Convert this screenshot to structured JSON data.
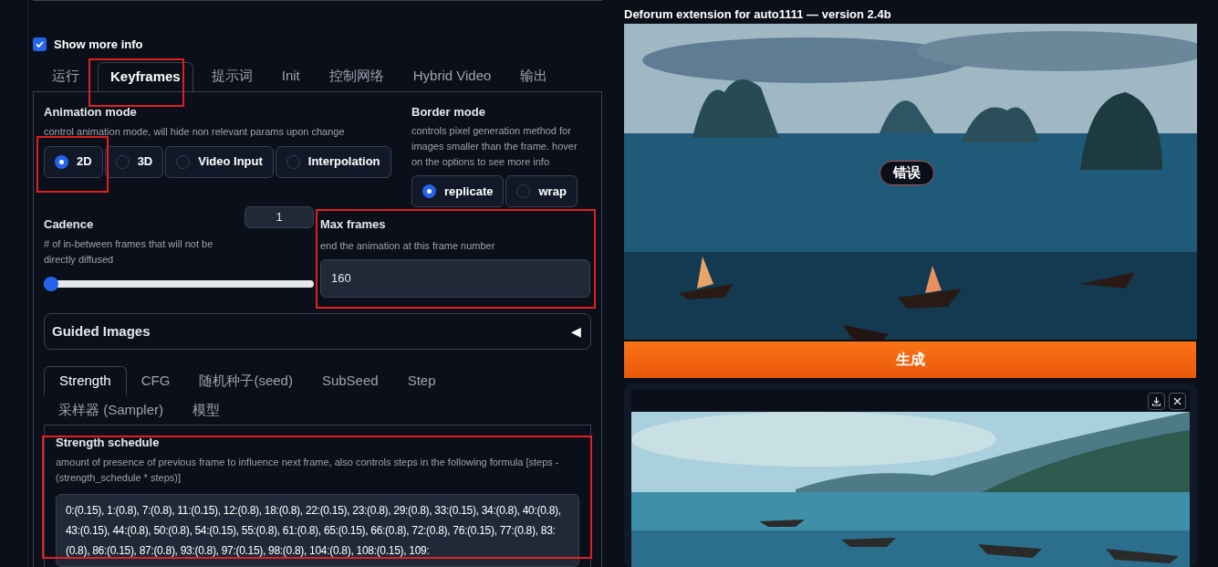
{
  "show_more_info": {
    "label": "Show more info",
    "checked": true
  },
  "tabs": [
    {
      "label": "运行",
      "selected": false
    },
    {
      "label": "Keyframes",
      "selected": true
    },
    {
      "label": "提示词",
      "selected": false
    },
    {
      "label": "Init",
      "selected": false
    },
    {
      "label": "控制网络",
      "selected": false
    },
    {
      "label": "Hybrid Video",
      "selected": false
    },
    {
      "label": "输出",
      "selected": false
    }
  ],
  "animation_mode": {
    "label": "Animation mode",
    "description": "control animation mode, will hide non relevant params upon change",
    "options": [
      {
        "label": "2D",
        "selected": true
      },
      {
        "label": "3D",
        "selected": false
      },
      {
        "label": "Video Input",
        "selected": false
      },
      {
        "label": "Interpolation",
        "selected": false
      }
    ]
  },
  "border_mode": {
    "label": "Border mode",
    "description": "controls pixel generation method for images smaller than the frame. hover on the options to see more info",
    "options": [
      {
        "label": "replicate",
        "selected": true
      },
      {
        "label": "wrap",
        "selected": false
      }
    ]
  },
  "cadence": {
    "label": "Cadence",
    "description": "# of in-between frames that will not be directly diffused",
    "value": "1",
    "level": 0
  },
  "max_frames": {
    "label": "Max frames",
    "description": "end the animation at this frame number",
    "value": "160"
  },
  "guided_images": {
    "label": "Guided Images",
    "toggle": "◀"
  },
  "schedule_tabs": [
    {
      "label": "Strength",
      "selected": true
    },
    {
      "label": "CFG",
      "selected": false
    },
    {
      "label": "随机种子(seed)",
      "selected": false
    },
    {
      "label": "SubSeed",
      "selected": false
    },
    {
      "label": "Step",
      "selected": false
    },
    {
      "label": "采样器 (Sampler)",
      "selected": false
    },
    {
      "label": "模型",
      "selected": false
    }
  ],
  "strength_schedule": {
    "label": "Strength schedule",
    "description": "amount of presence of previous frame to influence next frame, also controls steps in the following formula [steps - (strength_schedule * steps)]",
    "value": "0:(0.15), 1:(0.8), 7:(0.8), 11:(0.15), 12:(0.8), 18:(0.8), 22:(0.15), 23:(0.8), 29:(0.8), 33:(0.15), 34:(0.8), 40:(0.8), 43:(0.15), 44:(0.8), 50:(0.8), 54:(0.15), 55:(0.8), 61:(0.8), 65:(0.15), 66:(0.8), 72:(0.8), 76:(0.15), 77:(0.8), 83:(0.8), 86:(0.15), 87:(0.8), 93:(0.8), 97:(0.15), 98:(0.8), 104:(0.8), 108:(0.15), 109:"
  },
  "output": {
    "title": "Deforum extension for auto1111 — version 2.4b",
    "error_badge": "错误",
    "generate_button": "生成"
  }
}
